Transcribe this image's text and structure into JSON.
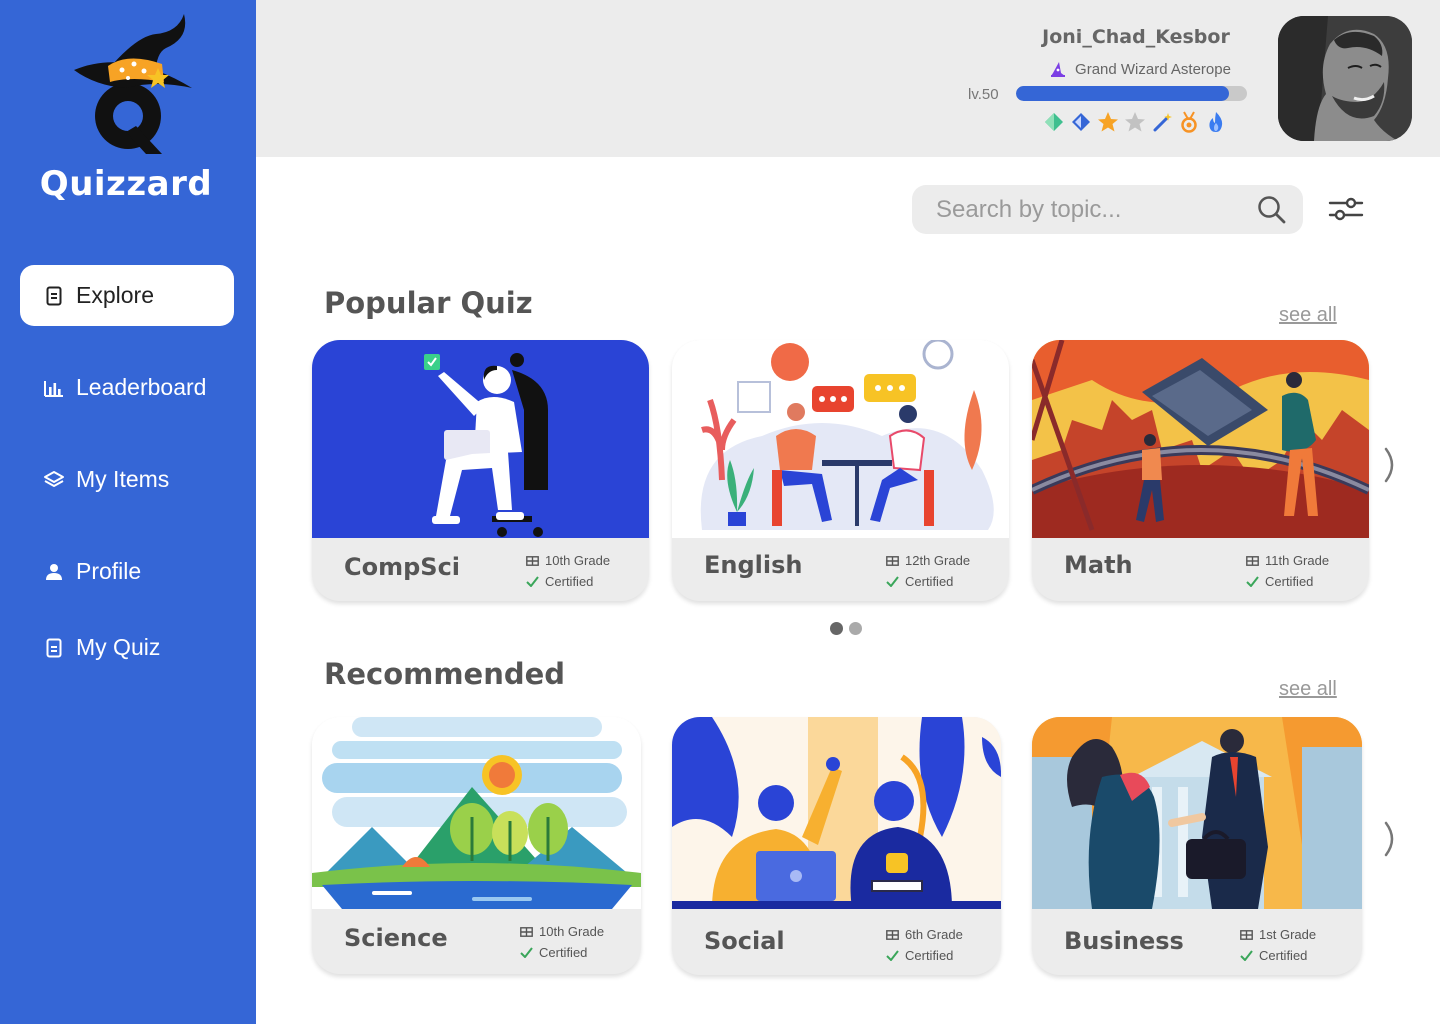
{
  "brand": {
    "name": "Quizzard"
  },
  "nav": {
    "items": [
      {
        "label": "Explore",
        "icon": "document-icon",
        "active": true
      },
      {
        "label": "Leaderboard",
        "icon": "bar-chart-icon",
        "active": false
      },
      {
        "label": "My Items",
        "icon": "layers-icon",
        "active": false
      },
      {
        "label": "Profile",
        "icon": "person-icon",
        "active": false
      },
      {
        "label": "My Quiz",
        "icon": "document-icon",
        "active": false
      }
    ]
  },
  "user": {
    "username": "Joni_Chad_Kesbor",
    "rank": "Grand Wizard Asterope",
    "level": "lv.50",
    "xp_progress": 0.92,
    "badges": [
      "emerald-gem-icon",
      "blue-gem-icon",
      "gold-star-icon",
      "gray-star-icon",
      "magic-wand-icon",
      "medal-icon",
      "flame-icon"
    ]
  },
  "search": {
    "placeholder": "Search by topic..."
  },
  "sections": {
    "popular": {
      "title": "Popular Quiz",
      "see_all": "see all",
      "cards": [
        {
          "title": "CompSci",
          "grade": "10th Grade",
          "status": "Certified"
        },
        {
          "title": "English",
          "grade": "12th Grade",
          "status": "Certified"
        },
        {
          "title": "Math",
          "grade": "11th Grade",
          "status": "Certified"
        }
      ],
      "pages": 2,
      "current_page": 1
    },
    "recommended": {
      "title": "Recommended",
      "see_all": "see all",
      "cards": [
        {
          "title": "Science",
          "grade": "10th Grade",
          "status": "Certified"
        },
        {
          "title": "Social",
          "grade": "6th Grade",
          "status": "Certified"
        },
        {
          "title": "Business",
          "grade": "1st Grade",
          "status": "Certified"
        }
      ]
    }
  },
  "colors": {
    "sidebar": "#3566d6",
    "accent": "#3566d6",
    "topbar": "#ececec",
    "certified_check": "#3aa65a"
  }
}
